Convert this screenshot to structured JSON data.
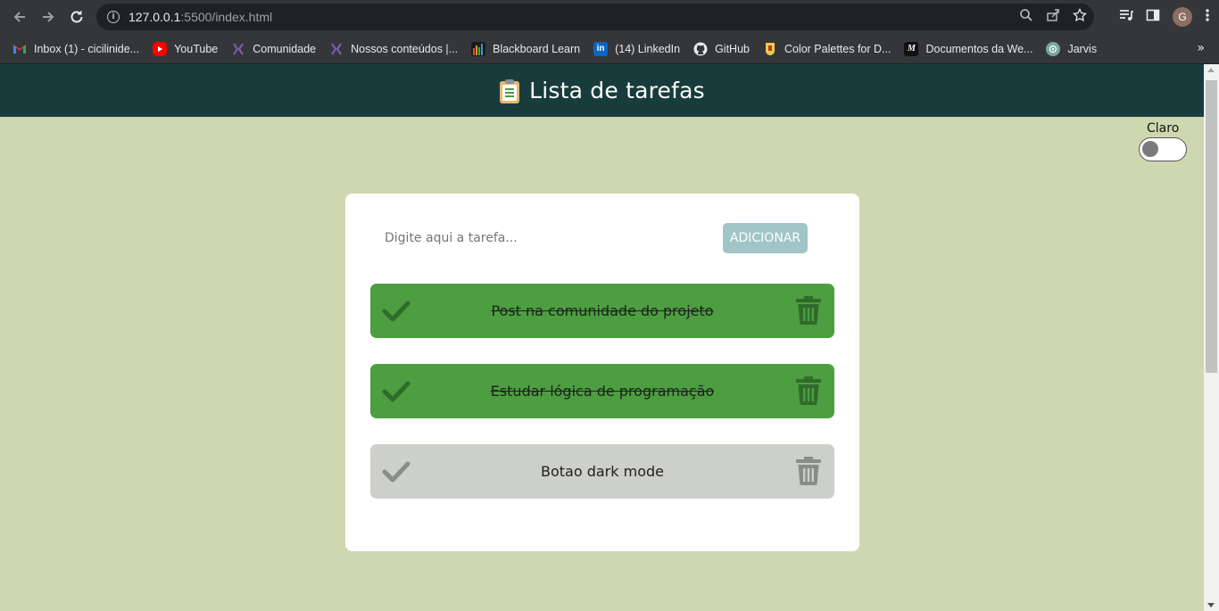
{
  "browser": {
    "url_host": "127.0.0.1",
    "url_path": ":5500/index.html",
    "avatar_letter": "G",
    "bookmarks": [
      {
        "label": "Inbox (1) - cicilinide...",
        "icon": "gmail-icon",
        "color": "#ea4335"
      },
      {
        "label": "YouTube",
        "icon": "youtube-icon",
        "color": "#ff0000"
      },
      {
        "label": "Comunidade",
        "icon": "community-icon",
        "color": "#6c4a9a"
      },
      {
        "label": "Nossos conteúdos |...",
        "icon": "community-icon",
        "color": "#6c4a9a"
      },
      {
        "label": "Blackboard Learn",
        "icon": "blackboard-icon",
        "color": "#c0392b"
      },
      {
        "label": "(14) LinkedIn",
        "icon": "linkedin-icon",
        "color": "#0a66c2"
      },
      {
        "label": "GitHub",
        "icon": "github-icon",
        "color": "#e8eaed"
      },
      {
        "label": "Color Palettes for D...",
        "icon": "palette-icon",
        "color": "#f2c94c"
      },
      {
        "label": "Documentos da We...",
        "icon": "mdn-icon",
        "color": "#111111"
      },
      {
        "label": "Jarvis",
        "icon": "openai-icon",
        "color": "#74aa9c"
      }
    ]
  },
  "app": {
    "title": "Lista de tarefas",
    "theme_label": "Claro",
    "theme_dark_enabled": false,
    "input_placeholder": "Digite aqui a tarefa...",
    "add_label": "ADICIONAR",
    "colors": {
      "header": "#183c3b",
      "background": "#cfd7b0",
      "done_task": "#4c9e41",
      "pending_task": "#cdcfcb",
      "add_button": "#9fc5c6"
    },
    "tasks": [
      {
        "text": "Post na comunidade do projeto",
        "done": true
      },
      {
        "text": "Estudar lógica de programação",
        "done": true
      },
      {
        "text": "Botao dark mode",
        "done": false
      }
    ]
  }
}
